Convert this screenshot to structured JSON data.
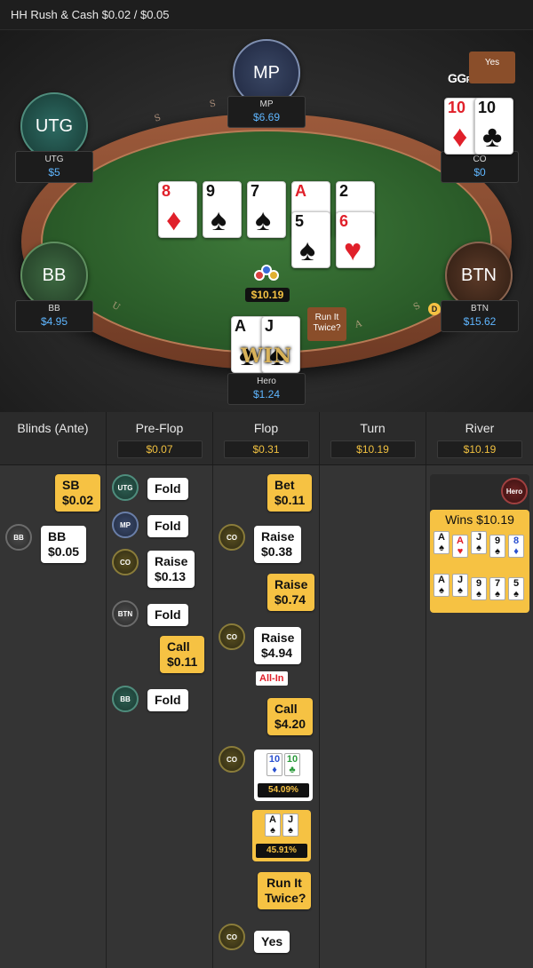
{
  "header": {
    "title": "HH  Rush & Cash $0.02 / $0.05"
  },
  "brand": {
    "logo": "GG",
    "logo_sub": "POKER"
  },
  "table": {
    "rail_letters": [
      "S",
      "S",
      "U",
      "S",
      "A"
    ],
    "dealer_button": "D",
    "pot": "$10.19",
    "seats": [
      {
        "id": "mp",
        "label": "MP",
        "name": "MP",
        "stack": "$6.69"
      },
      {
        "id": "utg",
        "label": "UTG",
        "name": "UTG",
        "stack": "$5"
      },
      {
        "id": "co",
        "label": "",
        "name": "CO",
        "stack": "$0",
        "bubble": "Yes"
      },
      {
        "id": "bb",
        "label": "BB",
        "name": "BB",
        "stack": "$4.95"
      },
      {
        "id": "btn",
        "label": "BTN",
        "name": "BTN",
        "stack": "$15.62"
      },
      {
        "id": "hero",
        "label": "",
        "name": "Hero",
        "stack": "$1.24",
        "bubble": "Run It Twice?",
        "win": "WIN"
      }
    ],
    "board_row1": [
      {
        "rank": "8",
        "suit": "♦",
        "color": "red"
      },
      {
        "rank": "9",
        "suit": "♠",
        "color": "blk"
      },
      {
        "rank": "7",
        "suit": "♠",
        "color": "blk"
      },
      {
        "rank": "A",
        "suit": "♥",
        "color": "red"
      },
      {
        "rank": "2",
        "suit": "♣",
        "color": "blk"
      }
    ],
    "board_row2": [
      {
        "rank": "5",
        "suit": "♠",
        "color": "blk"
      },
      {
        "rank": "6",
        "suit": "♥",
        "color": "red"
      }
    ],
    "co_cards": [
      {
        "rank": "10",
        "suit": "♦",
        "color": "red"
      },
      {
        "rank": "10",
        "suit": "♣",
        "color": "blk"
      }
    ],
    "hero_cards": [
      {
        "rank": "A",
        "suit": "♠",
        "color": "blk"
      },
      {
        "rank": "J",
        "suit": "♠",
        "color": "blk"
      }
    ]
  },
  "history": {
    "columns": [
      {
        "title": "Blinds (Ante)",
        "value": ""
      },
      {
        "title": "Pre-Flop",
        "value": "$0.07"
      },
      {
        "title": "Flop",
        "value": "$0.31"
      },
      {
        "title": "Turn",
        "value": "$10.19"
      },
      {
        "title": "River",
        "value": "$10.19"
      }
    ],
    "blinds": {
      "sb": {
        "action": "SB",
        "amount": "$0.02"
      },
      "bb": {
        "pos": "BB",
        "action": "BB",
        "amount": "$0.05"
      }
    },
    "preflop": [
      {
        "pos": "UTG",
        "action": "Fold"
      },
      {
        "pos": "MP",
        "action": "Fold"
      },
      {
        "pos": "CO",
        "action": "Raise",
        "amount": "$0.13"
      },
      {
        "pos": "BTN",
        "action": "Fold"
      },
      {
        "pos": "",
        "action": "Call",
        "amount": "$0.11"
      },
      {
        "pos": "BB",
        "action": "Fold"
      }
    ],
    "flop": [
      {
        "pos": "",
        "action": "Bet",
        "amount": "$0.11"
      },
      {
        "pos": "CO",
        "action": "Raise",
        "amount": "$0.38"
      },
      {
        "pos": "",
        "action": "Raise",
        "amount": "$0.74"
      },
      {
        "pos": "CO",
        "action": "Raise",
        "amount": "$4.94",
        "tag": "All-In"
      },
      {
        "pos": "",
        "action": "Call",
        "amount": "$4.20"
      },
      {
        "pos": "CO",
        "equity": "54.09%",
        "cards": [
          {
            "rank": "10",
            "suit": "♦",
            "color": "blue"
          },
          {
            "rank": "10",
            "suit": "♣",
            "color": "green"
          }
        ]
      },
      {
        "pos": "",
        "equity": "45.91%",
        "cards": [
          {
            "rank": "A",
            "suit": "♠",
            "color": "blk"
          },
          {
            "rank": "J",
            "suit": "♠",
            "color": "blk"
          }
        ]
      },
      {
        "pos": "",
        "action": "Run It Twice?"
      },
      {
        "pos": "CO",
        "action": "Yes"
      }
    ],
    "river": {
      "pos": "Hero",
      "result": "Wins $10.19",
      "board1": [
        {
          "rank": "A",
          "suit": "♠",
          "color": "blk"
        },
        {
          "rank": "A",
          "suit": "♥",
          "color": "red"
        },
        {
          "rank": "J",
          "suit": "♠",
          "color": "blk"
        },
        {
          "rank": "9",
          "suit": "♠",
          "color": "blk"
        },
        {
          "rank": "8",
          "suit": "♦",
          "color": "blue"
        }
      ],
      "board2": [
        {
          "rank": "A",
          "suit": "♠",
          "color": "blk"
        },
        {
          "rank": "J",
          "suit": "♠",
          "color": "blk"
        },
        {
          "rank": "9",
          "suit": "♠",
          "color": "blk"
        },
        {
          "rank": "7",
          "suit": "♠",
          "color": "blk"
        },
        {
          "rank": "5",
          "suit": "♠",
          "color": "blk"
        }
      ]
    }
  }
}
